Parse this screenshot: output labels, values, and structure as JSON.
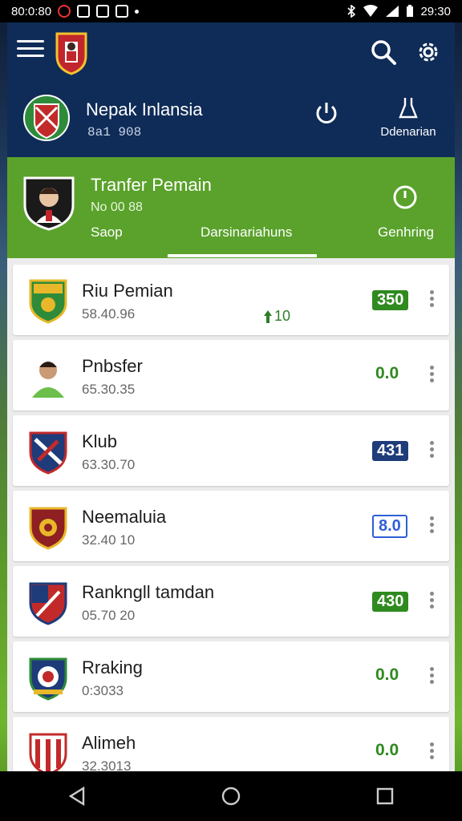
{
  "status_bar": {
    "left_text": "80:0:80",
    "right_text": "29:30"
  },
  "header": {
    "team_name": "Nepak Inlansia",
    "team_sub": "8a1 908",
    "flask_label": "Ddenarian"
  },
  "transfer_panel": {
    "title": "Tranfer Pemain",
    "subtitle": "No 00 88",
    "tabs": [
      "Saop",
      "Darsinariahuns",
      "Genhring"
    ]
  },
  "list": {
    "items": [
      {
        "name": "Riu Pemian",
        "meta": "58.40.96",
        "score": "350",
        "style": "box-green",
        "delta": "10"
      },
      {
        "name": "Pnbsfer",
        "meta": "65.30.35",
        "score": "0.0",
        "style": "text-green"
      },
      {
        "name": "Klub",
        "meta": "63.30.70",
        "score": "431",
        "style": "box-navy"
      },
      {
        "name": "Neemaluia",
        "meta": "32.40 10",
        "score": "8.0",
        "style": "box-blue"
      },
      {
        "name": "Rankngll tamdan",
        "meta": "05.70 20",
        "score": "430",
        "style": "box-green"
      },
      {
        "name": "Rraking",
        "meta": "0:3033",
        "score": "0.0",
        "style": "text-green"
      },
      {
        "name": "Alimeh",
        "meta": "32.3013",
        "score": "0.0",
        "style": "text-green"
      }
    ]
  },
  "colors": {
    "navy": "#0f2b57",
    "green": "#5aa22b",
    "score_green": "#2f8a1f",
    "score_blue": "#2f5fd6"
  },
  "icons": {
    "menu": "hamburger-icon",
    "search": "search-icon",
    "settings": "gear-icon",
    "power": "power-icon",
    "flask": "flask-icon",
    "more": "more-vert-icon"
  }
}
